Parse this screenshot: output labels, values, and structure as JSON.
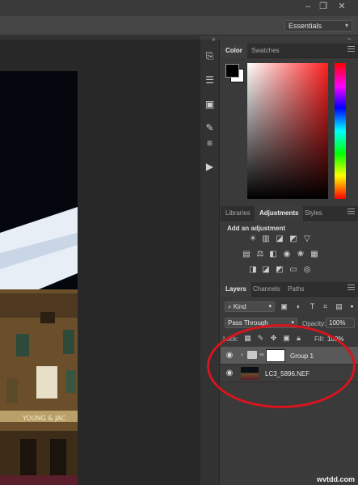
{
  "workspace": {
    "label": "Essentials"
  },
  "panels": {
    "color": {
      "tabs": [
        "Color",
        "Swatches"
      ],
      "foreground": "#000000",
      "background": "#ffffff"
    },
    "adjustments": {
      "tabs": [
        "Libraries",
        "Adjustments",
        "Styles"
      ],
      "subtitle": "Add an adjustment"
    },
    "layers": {
      "tabs": [
        "Layers",
        "Channels",
        "Paths"
      ],
      "filter_kind": "Kind",
      "blend_mode": "Pass Through",
      "opacity_label": "Opacity:",
      "opacity_value": "100%",
      "lock_label": "Lock:",
      "fill_label": "Fill:",
      "fill_value": "100%",
      "items": [
        {
          "name": "Group 1",
          "type": "group"
        },
        {
          "name": "LC3_5896.NEF",
          "type": "image"
        }
      ]
    }
  },
  "icons": [
    "history-icon",
    "properties-icon",
    "artboard-icon",
    "brush-icon",
    "sliders-icon",
    "play-icon"
  ],
  "annotation": {
    "ring_color": "#d8141e"
  },
  "watermark": "wvtdd.com"
}
